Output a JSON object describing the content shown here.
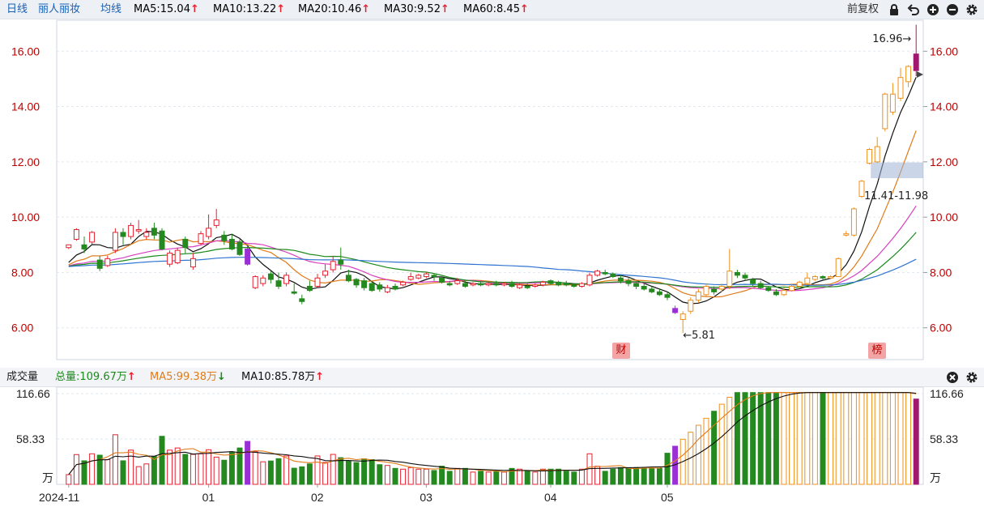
{
  "header": {
    "period": "日线",
    "stock_name": "丽人丽妆",
    "ma_label": "均线",
    "ma_items": [
      {
        "text": "MA5:15.04",
        "color": "#111111",
        "dir": "up"
      },
      {
        "text": "MA10:13.22",
        "color": "#e07b1a",
        "dir": "up"
      },
      {
        "text": "MA20:10.46",
        "color": "#d63fc0",
        "dir": "up"
      },
      {
        "text": "MA30:9.52",
        "color": "#1a8a1a",
        "dir": "up"
      },
      {
        "text": "MA60:8.45",
        "color": "#2f74d0",
        "dir": "up"
      }
    ],
    "adjust_label": "前复权",
    "up_arrow": "↑",
    "down_arrow": "↓"
  },
  "volume_header": {
    "title": "成交量",
    "items": [
      {
        "text": "总量:109.67万",
        "color": "#1a8a1a",
        "dir": "up"
      },
      {
        "text": "MA5:99.38万",
        "color": "#e07b1a",
        "dir": "down"
      },
      {
        "text": "MA10:85.78万",
        "color": "#111111",
        "dir": "up"
      }
    ]
  },
  "annotations": {
    "high_label": "16.96→",
    "low_label": "←5.81",
    "range_label": "11.41-11.98",
    "badge_cai": "财",
    "badge_bang": "榜"
  },
  "colors": {
    "up": "#e8212f",
    "down": "#24891f",
    "limit_up": "#f0901a",
    "special": "#9a2fd6",
    "last": "#a0186f",
    "ma5": "#111111",
    "ma10": "#e07b1a",
    "ma20": "#d63fc0",
    "ma30": "#1a8a1a",
    "ma60": "#2f74d0",
    "axis_text": "#c00000"
  },
  "chart_data": [
    {
      "type": "candlestick",
      "title": "丽人丽妆 日线 前复权",
      "xlabel": "",
      "ylabel": "",
      "ylim": [
        4.85,
        17.15
      ],
      "y_ticks": [
        6.0,
        8.0,
        10.0,
        12.0,
        14.0,
        16.0
      ],
      "y_tick_labels": [
        "6.00",
        "8.00",
        "10.00",
        "12.00",
        "14.00",
        "16.00"
      ],
      "x_tick_labels": [
        "2024-11",
        "01",
        "02",
        "03",
        "04",
        "05"
      ],
      "x_tick_index": [
        0,
        18,
        32,
        46,
        62,
        77
      ],
      "high": 16.96,
      "low": 5.81,
      "highlight_range": [
        11.41,
        11.98
      ],
      "candles": [
        [
          8.9,
          9.0,
          8.85,
          9.0
        ],
        [
          9.2,
          9.55,
          9.6,
          9.15
        ],
        [
          9.0,
          8.85,
          9.3,
          8.7
        ],
        [
          9.1,
          9.45,
          9.5,
          9.0
        ],
        [
          8.45,
          8.15,
          8.6,
          8.05
        ],
        [
          8.25,
          8.5,
          8.6,
          8.2
        ],
        [
          8.8,
          9.45,
          9.6,
          8.7
        ],
        [
          9.45,
          9.3,
          9.6,
          9.0
        ],
        [
          9.3,
          9.7,
          9.8,
          9.2
        ],
        [
          9.5,
          9.55,
          9.9,
          9.4
        ],
        [
          9.3,
          9.45,
          9.6,
          9.2
        ],
        [
          9.6,
          9.35,
          9.8,
          9.2
        ],
        [
          9.5,
          8.85,
          9.6,
          8.8
        ],
        [
          8.3,
          8.7,
          8.8,
          8.2
        ],
        [
          8.35,
          8.8,
          8.9,
          8.3
        ],
        [
          9.2,
          8.9,
          9.3,
          8.7
        ],
        [
          8.2,
          8.5,
          8.7,
          8.1
        ],
        [
          9.05,
          9.4,
          9.5,
          9.0
        ],
        [
          9.3,
          9.6,
          10.1,
          9.2
        ],
        [
          9.7,
          9.9,
          10.3,
          9.6
        ],
        [
          9.35,
          9.15,
          9.5,
          9.0
        ],
        [
          9.2,
          8.85,
          9.4,
          8.8
        ],
        [
          9.1,
          8.65,
          9.2,
          8.6
        ],
        [
          8.85,
          8.3,
          9.0,
          8.25
        ],
        [
          7.45,
          7.85,
          7.9,
          7.4
        ],
        [
          7.6,
          7.8,
          7.9,
          7.5
        ],
        [
          7.95,
          7.75,
          8.05,
          7.6
        ],
        [
          7.7,
          7.5,
          8.0,
          7.4
        ],
        [
          7.6,
          7.9,
          8.0,
          7.5
        ],
        [
          7.3,
          7.25,
          7.6,
          7.2
        ],
        [
          7.05,
          6.95,
          7.2,
          6.85
        ],
        [
          7.5,
          7.35,
          7.7,
          7.3
        ],
        [
          7.5,
          7.8,
          7.95,
          7.45
        ],
        [
          7.9,
          8.05,
          8.3,
          7.8
        ],
        [
          8.1,
          8.4,
          8.6,
          8.0
        ],
        [
          8.45,
          8.3,
          8.9,
          8.1
        ],
        [
          7.9,
          7.7,
          8.1,
          7.65
        ],
        [
          7.75,
          7.55,
          7.8,
          7.45
        ],
        [
          7.7,
          7.45,
          7.8,
          7.35
        ],
        [
          7.6,
          7.35,
          7.7,
          7.3
        ],
        [
          7.55,
          7.4,
          7.65,
          7.3
        ],
        [
          7.3,
          7.45,
          7.55,
          7.25
        ],
        [
          7.5,
          7.4,
          7.6,
          7.35
        ],
        [
          7.55,
          7.65,
          7.7,
          7.5
        ],
        [
          7.75,
          7.85,
          8.0,
          7.7
        ],
        [
          7.8,
          7.9,
          7.95,
          7.75
        ],
        [
          7.85,
          7.95,
          8.0,
          7.8
        ],
        [
          7.9,
          7.85,
          7.95,
          7.7
        ],
        [
          7.8,
          7.65,
          7.85,
          7.6
        ],
        [
          7.6,
          7.55,
          7.7,
          7.5
        ],
        [
          7.6,
          7.7,
          7.8,
          7.55
        ],
        [
          7.6,
          7.5,
          7.7,
          7.45
        ],
        [
          7.55,
          7.6,
          7.65,
          7.5
        ],
        [
          7.6,
          7.55,
          7.7,
          7.5
        ],
        [
          7.55,
          7.6,
          7.65,
          7.5
        ],
        [
          7.6,
          7.55,
          7.7,
          7.5
        ],
        [
          7.55,
          7.6,
          7.65,
          7.5
        ],
        [
          7.6,
          7.5,
          7.7,
          7.45
        ],
        [
          7.45,
          7.55,
          7.6,
          7.4
        ],
        [
          7.5,
          7.45,
          7.6,
          7.4
        ],
        [
          7.5,
          7.55,
          7.6,
          7.45
        ],
        [
          7.55,
          7.65,
          7.7,
          7.5
        ],
        [
          7.7,
          7.6,
          7.75,
          7.55
        ],
        [
          7.65,
          7.55,
          7.7,
          7.5
        ]
      ],
      "candles2": [
        [
          7.6,
          7.55,
          7.7,
          7.5
        ],
        [
          7.55,
          7.5,
          7.6,
          7.45
        ],
        [
          7.5,
          7.6,
          7.65,
          7.45
        ],
        [
          7.55,
          7.9,
          8.0,
          7.5
        ],
        [
          7.9,
          8.05,
          8.1,
          7.85
        ],
        [
          8.0,
          7.95,
          8.1,
          7.9
        ],
        [
          7.95,
          7.85,
          8.0,
          7.8
        ],
        [
          7.8,
          7.7,
          7.9,
          7.6
        ],
        [
          7.7,
          7.6,
          7.8,
          7.5
        ],
        [
          7.6,
          7.5,
          7.7,
          7.4
        ],
        [
          7.5,
          7.4,
          7.6,
          7.35
        ],
        [
          7.4,
          7.3,
          7.5,
          7.25
        ],
        [
          7.3,
          7.2,
          7.4,
          7.15
        ],
        [
          7.2,
          7.1,
          7.3,
          7.0
        ],
        [
          6.7,
          6.55,
          6.8,
          6.5
        ],
        [
          6.3,
          6.5,
          6.6,
          5.81
        ],
        [
          6.6,
          7.0,
          7.1,
          6.5
        ],
        [
          7.0,
          7.3,
          7.4,
          6.9
        ],
        [
          7.2,
          7.5,
          7.6,
          7.1
        ],
        [
          7.4,
          7.3,
          7.5,
          7.2
        ],
        [
          7.4,
          7.5,
          7.6,
          7.3
        ],
        [
          7.5,
          8.05,
          8.85,
          7.4
        ],
        [
          8.0,
          7.9,
          8.1,
          7.8
        ],
        [
          7.9,
          7.8,
          8.0,
          7.7
        ],
        [
          7.75,
          7.6,
          7.8,
          7.5
        ],
        [
          7.6,
          7.45,
          7.7,
          7.4
        ],
        [
          7.45,
          7.35,
          7.5,
          7.3
        ],
        [
          7.3,
          7.2,
          7.4,
          7.15
        ],
        [
          7.2,
          7.35,
          7.45,
          7.15
        ],
        [
          7.35,
          7.5,
          7.6,
          7.3
        ],
        [
          7.5,
          7.65,
          7.7,
          7.45
        ],
        [
          7.6,
          7.8,
          8.0,
          7.55
        ],
        [
          7.75,
          7.85,
          7.9,
          7.7
        ],
        [
          7.85,
          7.8,
          7.9,
          7.75
        ],
        [
          7.8,
          7.85,
          7.9,
          7.75
        ],
        [
          7.85,
          8.5,
          8.55,
          7.85
        ],
        [
          9.35,
          9.4,
          9.5,
          9.3
        ],
        [
          9.35,
          10.3,
          10.35,
          9.3
        ],
        [
          10.75,
          11.3,
          11.35,
          10.7
        ],
        [
          11.95,
          12.45,
          12.5,
          11.9
        ],
        [
          12.0,
          12.55,
          12.9,
          11.95
        ],
        [
          13.2,
          14.45,
          14.5,
          13.1
        ],
        [
          13.8,
          14.45,
          14.85,
          13.7
        ],
        [
          14.3,
          15.05,
          15.4,
          14.2
        ],
        [
          14.9,
          15.45,
          15.5,
          14.7
        ],
        [
          15.3,
          15.9,
          16.96,
          15.1
        ]
      ],
      "ma5_last": 15.04,
      "ma10_last": 13.22,
      "ma20_last": 10.46,
      "ma30_last": 9.52,
      "ma60_last": 8.45
    },
    {
      "type": "bar",
      "title": "成交量",
      "unit": "万",
      "ylim": [
        0,
        125
      ],
      "y_ticks": [
        58.33,
        116.66
      ],
      "y_tick_labels": [
        "58.33",
        "116.66"
      ],
      "total": 109.67,
      "ma5": 99.38,
      "ma10": 85.78
    }
  ]
}
